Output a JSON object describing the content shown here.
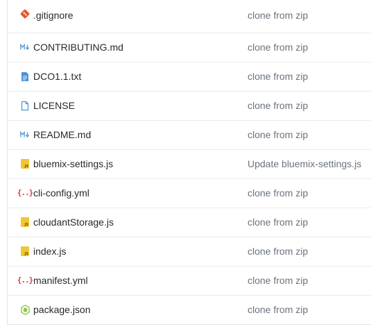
{
  "files": [
    {
      "name": ".gitignore",
      "message": "clone from zip",
      "icon": "git-icon"
    },
    {
      "name": "CONTRIBUTING.md",
      "message": "clone from zip",
      "icon": "markdown-icon"
    },
    {
      "name": "DCO1.1.txt",
      "message": "clone from zip",
      "icon": "text-file-icon"
    },
    {
      "name": "LICENSE",
      "message": "clone from zip",
      "icon": "file-icon"
    },
    {
      "name": "README.md",
      "message": "clone from zip",
      "icon": "markdown-icon"
    },
    {
      "name": "bluemix-settings.js",
      "message": "Update bluemix-settings.js",
      "icon": "javascript-icon"
    },
    {
      "name": "cli-config.yml",
      "message": "clone from zip",
      "icon": "yaml-icon"
    },
    {
      "name": "cloudantStorage.js",
      "message": "clone from zip",
      "icon": "javascript-icon"
    },
    {
      "name": "index.js",
      "message": "clone from zip",
      "icon": "javascript-icon"
    },
    {
      "name": "manifest.yml",
      "message": "clone from zip",
      "icon": "yaml-icon"
    },
    {
      "name": "package.json",
      "message": "clone from zip",
      "icon": "nodejs-icon"
    }
  ],
  "colors": {
    "git": "#e4572e",
    "markdown": "#5a9bd5",
    "text_file": "#4a90d9",
    "file": "#4a90d9",
    "javascript": "#f1c533",
    "yaml": "#e3352b",
    "nodejs": "#8cc84b"
  }
}
